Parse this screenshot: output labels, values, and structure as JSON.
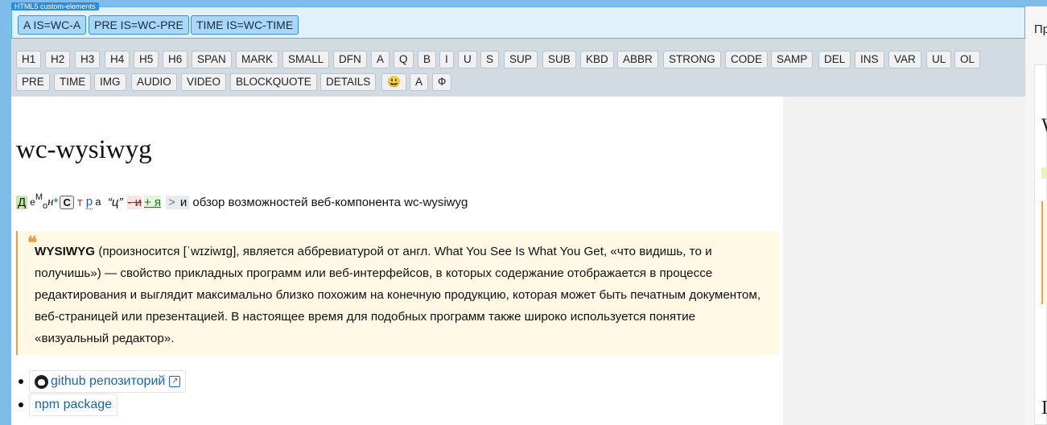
{
  "custom": {
    "badge": "HTML5 custom-elements",
    "buttons": [
      "A IS=WC-A",
      "PRE IS=WC-PRE",
      "TIME IS=WC-TIME"
    ]
  },
  "toolbar": {
    "row1": [
      "H1",
      "H2",
      "H3",
      "H4",
      "H5",
      "H6",
      "SPAN",
      "MARK",
      "SMALL",
      "DFN",
      "A",
      "Q",
      "B",
      "I",
      "U",
      "S",
      "SUP",
      "SUB",
      "KBD",
      "ABBR",
      "STRONG",
      "CODE",
      "SAMP",
      "DEL",
      "INS",
      "VAR",
      "UL",
      "OL"
    ],
    "row2": [
      "PRE",
      "TIME",
      "IMG",
      "AUDIO",
      "VIDEO",
      "BLOCKQUOTE",
      "DETAILS",
      "😃",
      "A",
      "Ф"
    ]
  },
  "doc": {
    "title": "wc-wysiwyg",
    "demo_marks": [
      "Д",
      "е",
      "М",
      "о",
      "н",
      "*",
      "С",
      "т",
      "р",
      "а",
      "“ц”",
      "- и",
      "+ я",
      ">",
      "и"
    ],
    "demo_text": " обзор возможностей веб-компонента wc-wysiwyg",
    "quote_mark": "❝",
    "quote_bold": "WYSIWYG",
    "quote_text": " (произносится [ˈwɪziwɪg], является аббревиатурой от англ. What You See Is What You Get, «что видишь, то и получишь») — свойство прикладных программ или веб-интерфейсов, в которых содержание отображается в процессе редактирования и выглядит максимально близко похожим на конечную продукцию, которая может быть печатным документом, веб-страницей или презентацией. В настоящее время для подобных программ также широко используется понятие «визуальный редактор».",
    "links": [
      "github репозиторий",
      "npm package"
    ],
    "ext_icon": "↗"
  },
  "side": {
    "peek_text": "Пр",
    "peek_w": "W",
    "peek_i": "I"
  },
  "colors": {
    "accent": "#2a8be0",
    "custom_bg": "#e1f2fd",
    "toolbar_bg": "#d2dbe1",
    "quote_border": "#f09a4a"
  }
}
